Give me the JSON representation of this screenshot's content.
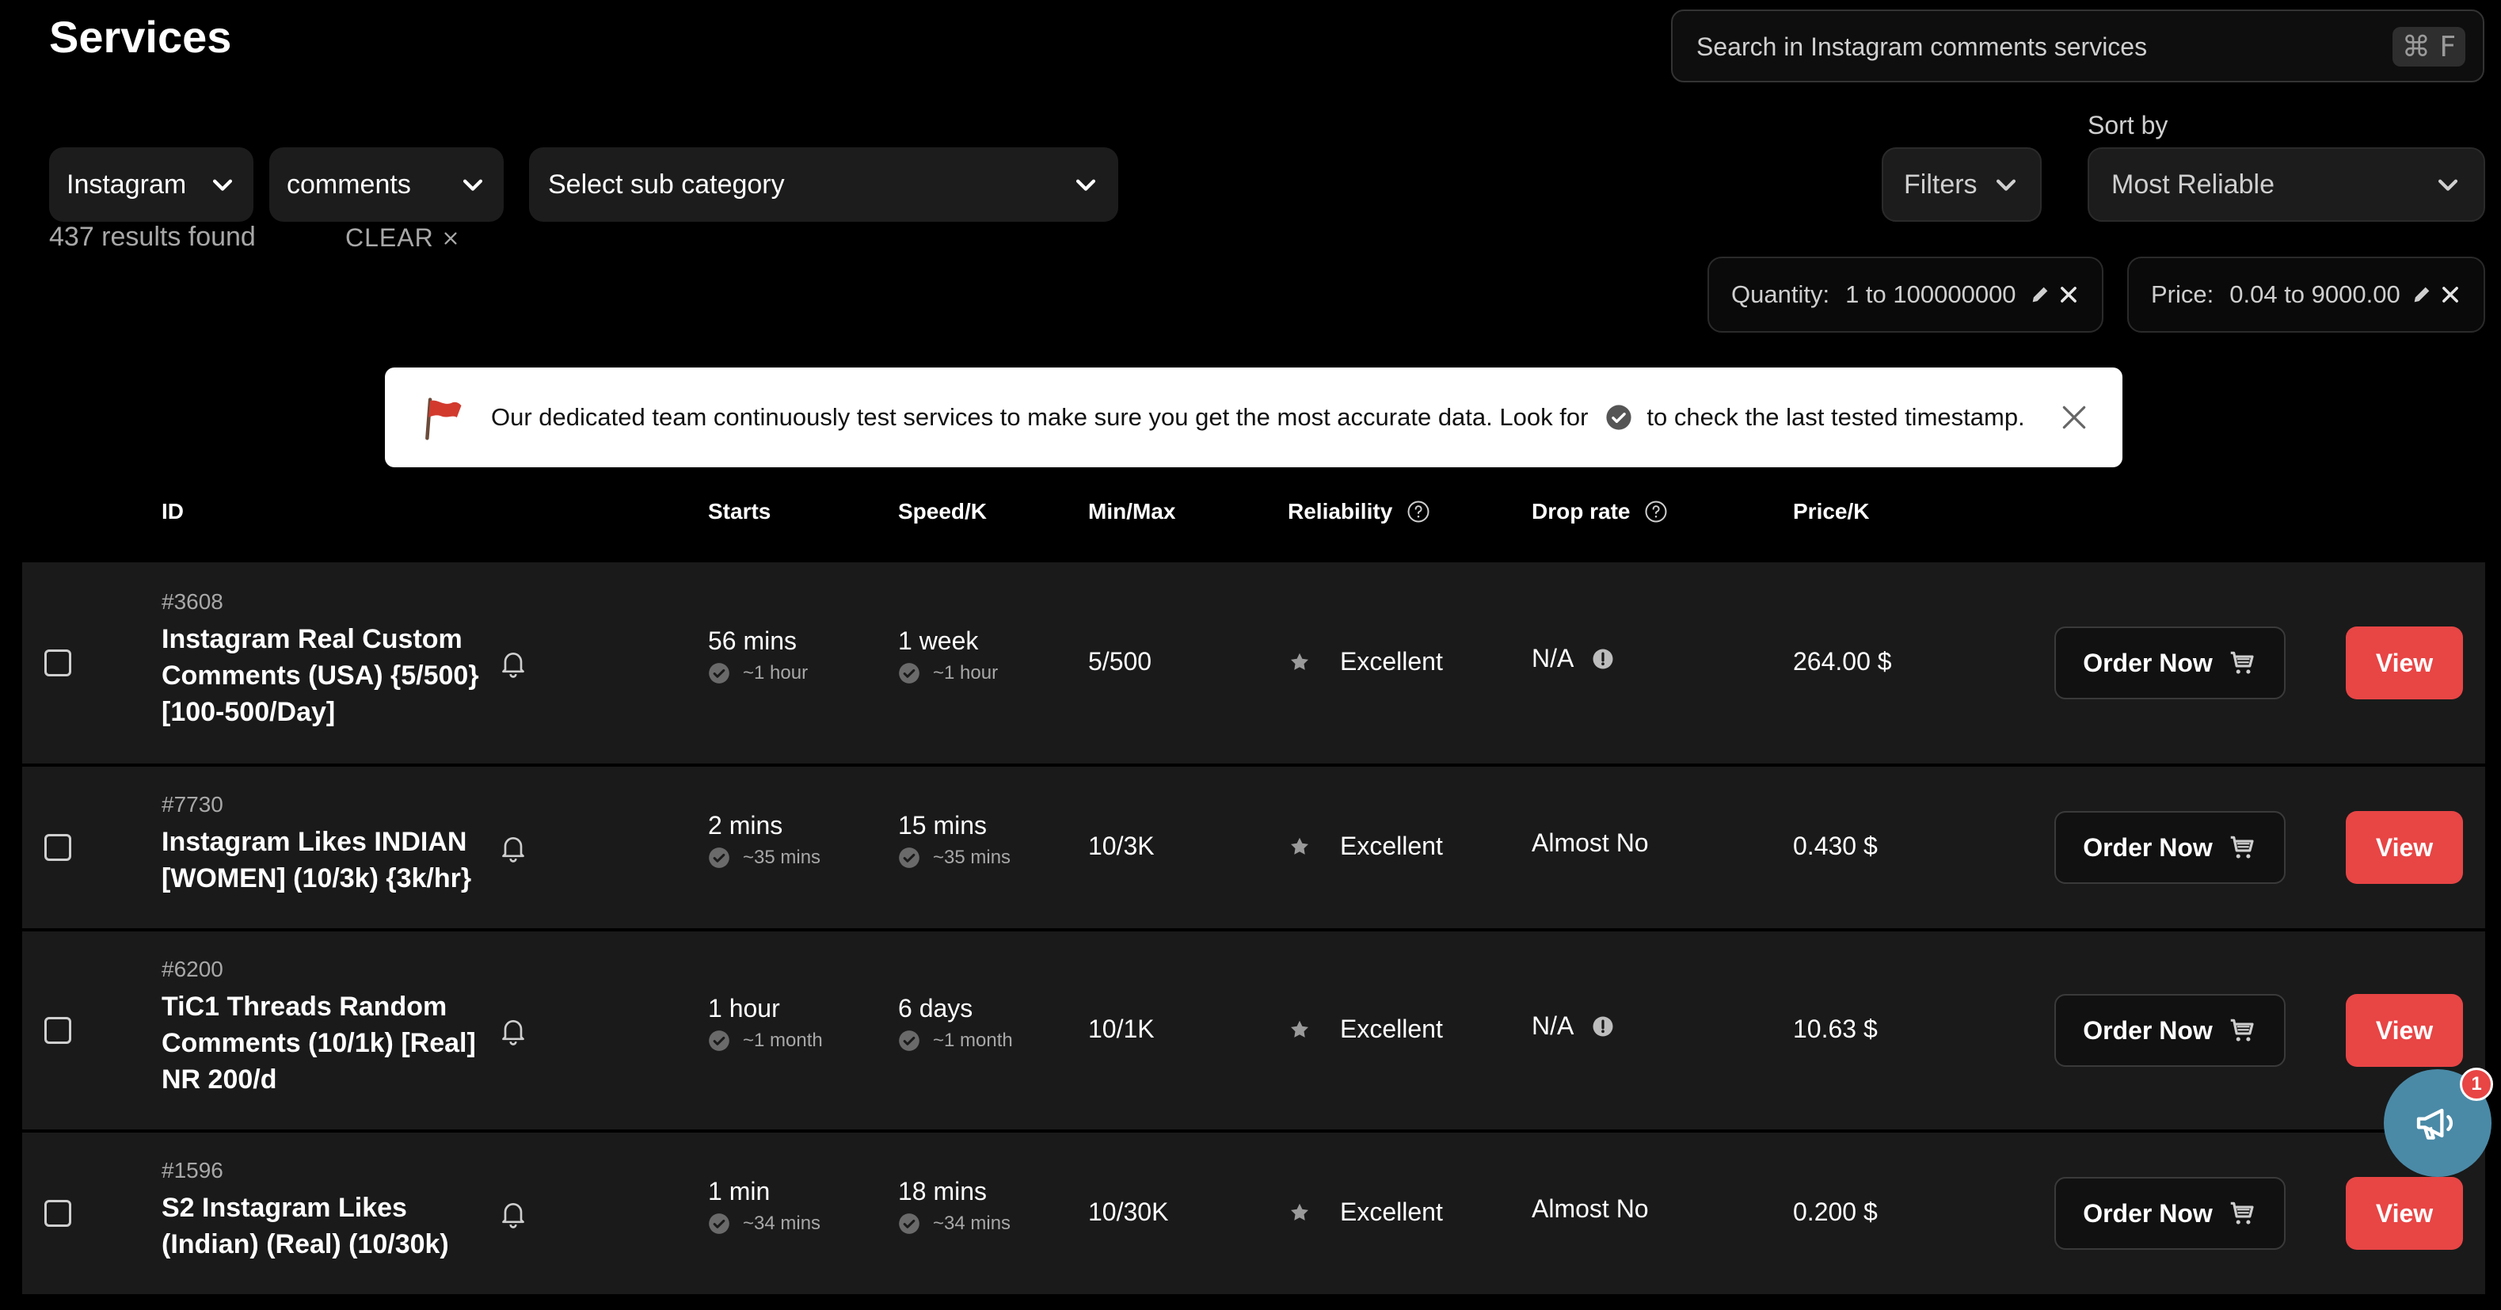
{
  "header": {
    "title": "Services",
    "search_placeholder": "Search in Instagram comments services",
    "shortcut": "⌘ F"
  },
  "filters": {
    "platform": "Instagram",
    "category": "comments",
    "subcategory_placeholder": "Select sub category",
    "filters_label": "Filters",
    "sort_label": "Sort by",
    "sort_value": "Most Reliable",
    "results_text": "437 results found",
    "clear_label": "CLEAR",
    "quantity_label": "Quantity:",
    "quantity_value": "1 to 100000000",
    "price_label": "Price:",
    "price_value": "0.04 to 9000.00"
  },
  "notice": {
    "text_before": "Our dedicated team continuously test services to make sure you get the most accurate data. Look for",
    "text_after": "to check the last tested timestamp."
  },
  "table": {
    "headers": {
      "id": "ID",
      "starts": "Starts",
      "speed": "Speed/K",
      "minmax": "Min/Max",
      "reliability": "Reliability",
      "droprate": "Drop rate",
      "price": "Price/K"
    },
    "order_label": "Order Now",
    "view_label": "View",
    "rows": [
      {
        "id": "#3608",
        "name": "Instagram Real Custom Comments (USA) {5/500} [100-500/Day]",
        "starts": "56 mins",
        "starts_tested": "~1 hour",
        "speed": "1 week",
        "speed_tested": "~1 hour",
        "minmax": "5/500",
        "reliability": "Excellent",
        "droprate": "N/A",
        "price": "264.00 $"
      },
      {
        "id": "#7730",
        "name": "Instagram Likes INDIAN [WOMEN] (10/3k) {3k/hr}",
        "starts": "2 mins",
        "starts_tested": "~35 mins",
        "speed": "15 mins",
        "speed_tested": "~35 mins",
        "minmax": "10/3K",
        "reliability": "Excellent",
        "droprate": "Almost No",
        "price": "0.430 $"
      },
      {
        "id": "#6200",
        "name": "TiC1 Threads Random Comments (10/1k) [Real] NR 200/d",
        "starts": "1 hour",
        "starts_tested": "~1 month",
        "speed": "6 days",
        "speed_tested": "~1 month",
        "minmax": "10/1K",
        "reliability": "Excellent",
        "droprate": "N/A",
        "price": "10.63 $"
      },
      {
        "id": "#1596",
        "name": "S2 Instagram Likes (Indian) (Real) (10/30k)",
        "starts": "1 min",
        "starts_tested": "~34 mins",
        "speed": "18 mins",
        "speed_tested": "~34 mins",
        "minmax": "10/30K",
        "reliability": "Excellent",
        "droprate": "Almost No",
        "price": "0.200 $"
      }
    ]
  },
  "fab": {
    "badge": "1"
  }
}
